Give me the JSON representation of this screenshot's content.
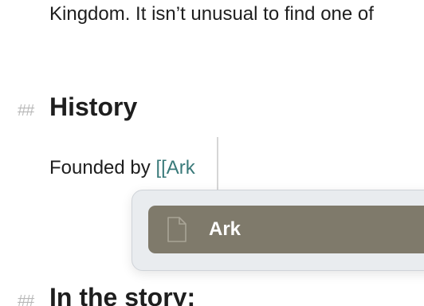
{
  "document": {
    "intro_line": "Kingdom. It isn’t unusual to find one of",
    "heading_marker": "##",
    "history_heading": "History",
    "founded_prefix": "Founded by ",
    "link_input": "[[Ark",
    "story_heading": "In the story:"
  },
  "autocomplete": {
    "items": [
      {
        "label": "Ark",
        "icon": "document-icon"
      }
    ],
    "selected_index": 0
  },
  "colors": {
    "link": "#3a7a7a",
    "selected_item_bg": "#7f7a6b",
    "popup_bg": "#e9ecef",
    "heading_marker": "#b8b8b8"
  }
}
